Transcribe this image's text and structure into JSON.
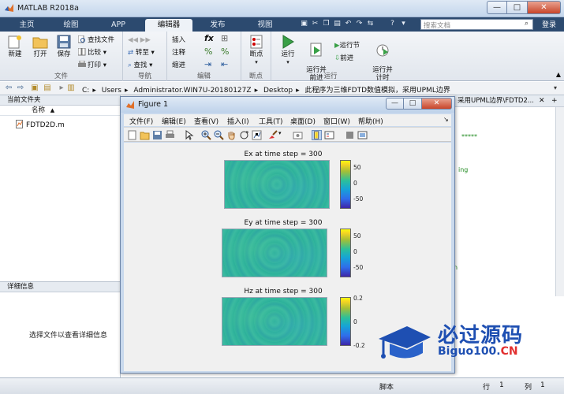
{
  "window": {
    "title": "MATLAB R2018a",
    "minimize": "—",
    "maximize": "□",
    "close": "✕"
  },
  "tabs": [
    "主页",
    "绘图",
    "APP",
    "编辑器",
    "发布",
    "视图"
  ],
  "active_tab": "编辑器",
  "search": {
    "placeholder": "搜索文档"
  },
  "login": "登录",
  "ribbon": {
    "file": {
      "label": "文件",
      "new": "新建",
      "open": "打开",
      "save": "保存",
      "find_files": "查找文件",
      "compare": "比较",
      "print": "打印"
    },
    "nav": {
      "label": "导航",
      "goto": "转至",
      "find": "查找"
    },
    "edit": {
      "label": "编辑",
      "insert": "插入",
      "comment": "注释",
      "indent": "缩进"
    },
    "breakpoint": {
      "label": "断点",
      "breakpoints": "断点"
    },
    "run": {
      "label": "运行",
      "run": "运行",
      "run_advance": "运行并\n前进",
      "run_section": "运行节",
      "advance": "前进",
      "run_time": "运行并\n计时"
    }
  },
  "address": {
    "crumbs": [
      "C:",
      "Users",
      "Administrator.WIN7U-20180127Z",
      "Desktop",
      "此程序为三维FDTD数值模拟，采用UPML边界"
    ]
  },
  "current_folder": {
    "title": "当前文件夹",
    "column": "名称",
    "sort": "▲",
    "files": [
      "FDTD2D.m"
    ]
  },
  "details": {
    "title": "详细信息",
    "empty_text": "选择文件以查看详细信息"
  },
  "editor": {
    "tab_label": "采用UPML边界\\FDTD2...",
    "lines": [
      {
        "text": "*****"
      },
      {
        "text": "ing"
      },
      {
        "text": "n"
      }
    ]
  },
  "status": {
    "script": "脚本",
    "row_label": "行",
    "row": "1",
    "col_label": "列",
    "col": "1"
  },
  "figure": {
    "title": "Figure 1",
    "menus": [
      "文件(F)",
      "编辑(E)",
      "查看(V)",
      "插入(I)",
      "工具(T)",
      "桌面(D)",
      "窗口(W)",
      "帮助(H)"
    ],
    "toolbar_icons": [
      "new-figure-icon",
      "open-icon",
      "save-icon",
      "print-icon",
      "pointer-icon",
      "zoom-in-icon",
      "zoom-out-icon",
      "pan-icon",
      "rotate-icon",
      "data-cursor-icon",
      "brush-icon",
      "link-icon",
      "colorbar-icon",
      "legend-icon",
      "hide-plot-tools-icon",
      "show-plot-tools-icon"
    ]
  },
  "chart_data": [
    {
      "type": "heatmap",
      "title": "Ex at time step = 300",
      "colorbar_ticks": [
        "50",
        "0",
        "-50"
      ],
      "colorbar_range": [
        -60,
        60
      ],
      "colormap": "parula"
    },
    {
      "type": "heatmap",
      "title": "Ey at time step = 300",
      "colorbar_ticks": [
        "50",
        "0",
        "-50"
      ],
      "colorbar_range": [
        -60,
        60
      ],
      "colormap": "parula"
    },
    {
      "type": "heatmap",
      "title": "Hz at time step = 300",
      "colorbar_ticks": [
        "0.2",
        "0",
        "-0.2"
      ],
      "colorbar_range": [
        -0.25,
        0.25
      ],
      "colormap": "parula"
    }
  ],
  "watermark": {
    "cn": "必过源码",
    "en_main": "Biguo100.",
    "en_suffix": "CN"
  },
  "colors": {
    "tabbar": "#2c4a6f",
    "accent": "#1e4fb2",
    "watermark_red": "#e23030"
  }
}
